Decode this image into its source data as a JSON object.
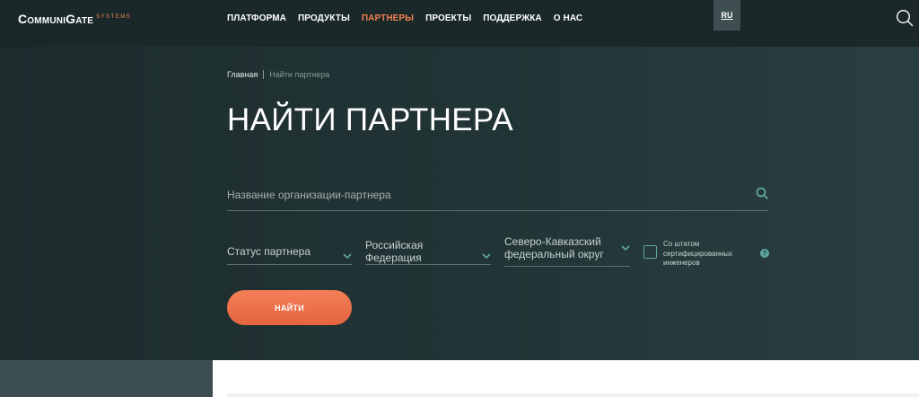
{
  "header": {
    "logo": {
      "main": "CommuniGate",
      "sub": "SYSTEMS"
    },
    "nav": [
      {
        "label": "ПЛАТФОРМА"
      },
      {
        "label": "ПРОДУКТЫ"
      },
      {
        "label": "ПАРТНЕРЫ",
        "active": true
      },
      {
        "label": "ПРОЕКТЫ"
      },
      {
        "label": "ПОДДЕРЖКА"
      },
      {
        "label": "О НАС"
      }
    ],
    "lang": "RU",
    "search_icon": "search-icon"
  },
  "breadcrumb": {
    "home": "Главная",
    "current": "Найти партнера"
  },
  "page_title": "НАЙТИ ПАРТНЕРА",
  "search": {
    "placeholder": "Название организации-партнера",
    "value": ""
  },
  "filters": {
    "status": "Статус партнера",
    "country": "Российская Федерация",
    "region_line1": "Северо-Кавказский",
    "region_line2": "федеральный округ",
    "certified_label": "Со штатом сертифицированных инженеров",
    "certified_checked": false,
    "help": "?"
  },
  "find_button": "НАЙТИ",
  "colors": {
    "accent": "#ef8050",
    "teal": "#5fa5a2",
    "background": "#1e2d2e"
  }
}
